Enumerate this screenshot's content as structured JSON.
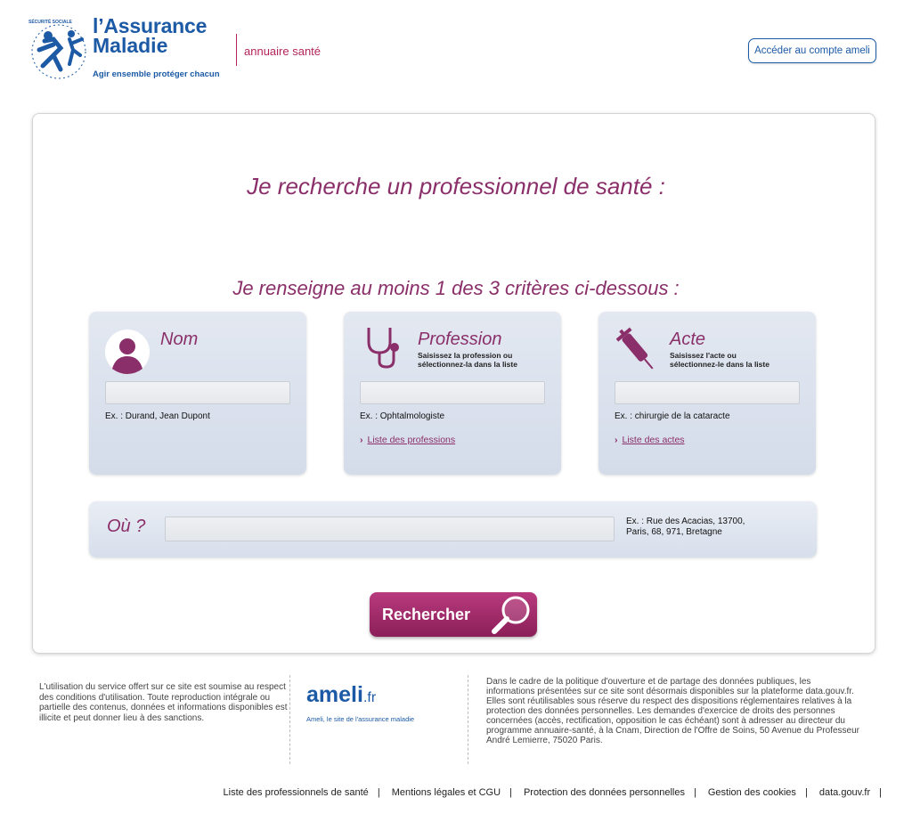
{
  "header": {
    "logo_arc": "SÉCURITÉ SOCIALE",
    "logo_line1": "l’Assurance",
    "logo_line2": "Maladie",
    "logo_tagline": "Agir ensemble  protéger chacun",
    "site_name": "annuaire santé",
    "account_button": "Accéder au compte ameli"
  },
  "main": {
    "title": "Je recherche un professionnel de santé :",
    "subtitle": "Je renseigne au moins 1 des 3 critères ci-dessous :",
    "criteria": [
      {
        "title": "Nom",
        "hint": "",
        "example": "Ex. : Durand, Jean Dupont",
        "link": ""
      },
      {
        "title": "Profession",
        "hint_line1": "Saisissez la profession ou",
        "hint_line2": "sélectionnez-la dans la liste",
        "example": "Ex. : Ophtalmologiste",
        "link": "Liste des professions"
      },
      {
        "title": "Acte",
        "hint_line1": "Saisissez l'acte ou",
        "hint_line2": "sélectionnez-le dans la liste",
        "example": "Ex. : chirurgie de la cataracte",
        "link": "Liste des actes"
      }
    ],
    "where": {
      "label": "Où ?",
      "example_line1": "Ex. : Rue des Acacias, 13700,",
      "example_line2": "Paris, 68, 971, Bretagne"
    },
    "search_button": "Rechercher"
  },
  "footer": {
    "left_text": "L'utilisation du service offert sur ce site est soumise au respect des conditions d'utilisation. Toute reproduction intégrale ou partielle des contenus, données et informations disponibles est illicite et peut donner lieu à des sanctions.",
    "ameli_logo": "ameli",
    "ameli_logo_suffix": ".fr",
    "ameli_tagline": "Ameli, le site de l'assurance maladie",
    "right_text": "Dans le cadre de la politique d'ouverture et de partage des données publiques, les informations présentées sur ce site sont désormais disponibles sur la plateforme data.gouv.fr. Elles sont réutilisables sous réserve du respect des dispositions réglementaires relatives à la protection des données personnelles. Les demandes d'exercice de droits des personnes concernées (accès, rectification, opposition le cas échéant) sont à adresser au directeur du programme annuaire-santé, à la Cnam, Direction de l'Offre de Soins, 50 Avenue du Professeur André Lemierre, 75020 Paris.",
    "links": [
      "Liste des professionnels de santé",
      "Mentions légales et CGU",
      "Protection des données personnelles",
      "Gestion des cookies",
      "data.gouv.fr"
    ]
  },
  "colors": {
    "brand_blue": "#1c5aa6",
    "accent_magenta": "#8a2f69",
    "button_magenta": "#a22c6c"
  },
  "icons": [
    "assurance-maladie-logo-icon",
    "person-icon",
    "stethoscope-icon",
    "syringe-icon",
    "magnifier-icon"
  ]
}
